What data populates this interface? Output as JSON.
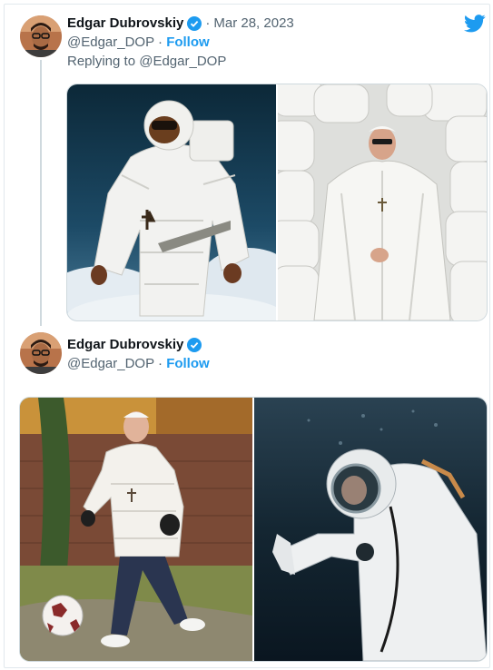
{
  "tweet1": {
    "author": "Edgar Dubrovskiy",
    "separator": "·",
    "date": "Mar 28, 2023",
    "handle": "@Edgar_DOP",
    "dot": "·",
    "follow": "Follow",
    "replying_prefix": "Replying to ",
    "replying_handle": "@Edgar_DOP",
    "images": [
      "astronaut-in-white-puffer-suit-over-clouds",
      "pope-in-white-puffer-coat-among-pillows"
    ]
  },
  "tweet2": {
    "author": "Edgar Dubrovskiy",
    "handle": "@Edgar_DOP",
    "dot": "·",
    "follow": "Follow",
    "images": [
      "pope-in-white-puffer-jacket-kicking-football",
      "diver-in-white-suit-underwater"
    ]
  },
  "colors": {
    "accent": "#1d9bf0",
    "muted": "#536471",
    "text": "#0f1419"
  },
  "icons": [
    "twitter-bird-icon",
    "verified-badge-icon"
  ]
}
